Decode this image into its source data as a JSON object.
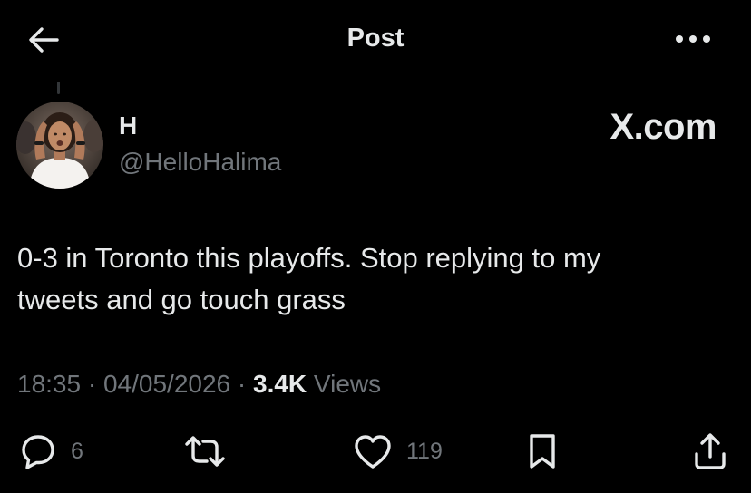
{
  "header": {
    "title": "Post",
    "back_icon": "arrow-left-icon",
    "more_icon": "more-horizontal-icon"
  },
  "author": {
    "display_name": "H",
    "handle": "@HelloHalima"
  },
  "watermark": "X.com",
  "tweet": {
    "line1": "0-3 in Toronto this playoffs. Stop replying to my",
    "line2": "tweets and go touch grass"
  },
  "meta": {
    "time": "18:35",
    "separator": " · ",
    "date": "04/05/2026",
    "views_count": "3.4K",
    "views_label": " Views"
  },
  "actions": {
    "replies": {
      "icon": "reply-icon",
      "count": "6"
    },
    "reposts": {
      "icon": "repost-icon",
      "count": ""
    },
    "likes": {
      "icon": "heart-icon",
      "count": "119"
    },
    "bookmark": {
      "icon": "bookmark-icon"
    },
    "share": {
      "icon": "share-icon"
    }
  },
  "colors": {
    "background": "#000000",
    "primary_text": "#e7e9ea",
    "secondary_text": "#71767b"
  }
}
